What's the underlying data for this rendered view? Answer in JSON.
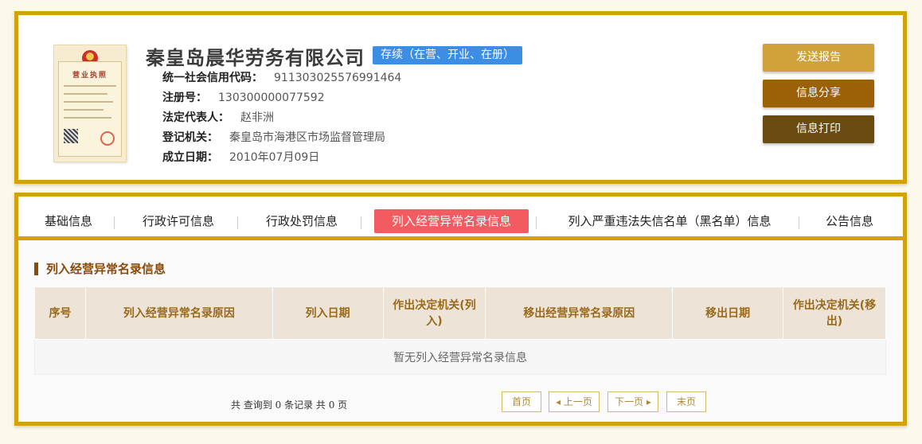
{
  "company": {
    "name": "秦皇岛晨华劳务有限公司",
    "status": "存续（在营、开业、在册）",
    "license_title": "营业执照",
    "info": [
      {
        "label": "统一社会信用代码：",
        "value": "911303025576991464"
      },
      {
        "label": "注册号：",
        "value": "130300000077592"
      },
      {
        "label": "法定代表人：",
        "value": "赵非洲"
      },
      {
        "label": "登记机关：",
        "value": "秦皇岛市海港区市场监督管理局"
      },
      {
        "label": "成立日期：",
        "value": "2010年07月09日"
      }
    ]
  },
  "actions": {
    "send_report": "发送报告",
    "share": "信息分享",
    "print": "信息打印"
  },
  "colors": {
    "send_report": "#d0a33a",
    "share": "#9c6106",
    "print": "#6b4c10",
    "border": "#d2a10c",
    "active_tab": "#f25b5f"
  },
  "tabs": [
    {
      "label": "基础信息",
      "active": false
    },
    {
      "label": "行政许可信息",
      "active": false
    },
    {
      "label": "行政处罚信息",
      "active": false
    },
    {
      "label": "列入经营异常名录信息",
      "active": true
    },
    {
      "label": "列入严重违法失信名单（黑名单）信息",
      "active": false
    },
    {
      "label": "公告信息",
      "active": false
    }
  ],
  "section": {
    "title": "列入经营异常名录信息",
    "columns": [
      "序号",
      "列入经营异常名录原因",
      "列入日期",
      "作出决定机关(列入)",
      "移出经营异常名录原因",
      "移出日期",
      "作出决定机关(移出)"
    ],
    "empty_message": "暂无列入经营异常名录信息"
  },
  "pager": {
    "info": "共 查询到 0 条记录 共 0 页",
    "first": "首页",
    "prev": "上一页",
    "next": "下一页",
    "last": "末页"
  }
}
